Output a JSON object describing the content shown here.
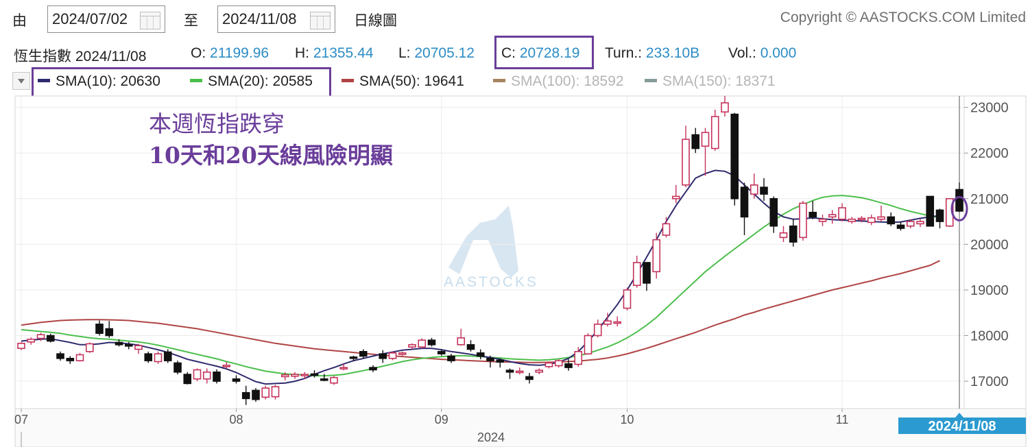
{
  "toolbar": {
    "from_label": "由",
    "from_date": "2024/07/02",
    "to_label": "至",
    "to_date": "2024/11/08",
    "chart_type": "日線圖",
    "copyright": "Copyright © AASTOCKS.COM Limited"
  },
  "quote": {
    "name": "恆生指數",
    "date": "2024/11/08",
    "open_label": "O:",
    "open": "21199.96",
    "high_label": "H:",
    "high": "21355.44",
    "low_label": "L:",
    "low": "20705.12",
    "close_label": "C:",
    "close": "20728.19",
    "turnover_label": "Turn.:",
    "turnover": "233.10B",
    "volume_label": "Vol.:",
    "volume": "0.000"
  },
  "indicators": [
    {
      "label": "SMA(10): 20630",
      "color": "#2e2a6e",
      "active": true
    },
    {
      "label": "SMA(20): 20585",
      "color": "#4bbf4b",
      "active": true
    },
    {
      "label": "SMA(50): 19641",
      "color": "#b04444",
      "active": true
    },
    {
      "label": "SMA(100): 18592",
      "color": "#8b5a2b",
      "active": false
    },
    {
      "label": "SMA(150): 18371",
      "color": "#5f7a78",
      "active": false
    }
  ],
  "annotation": {
    "line1": "本週恆指跌穿",
    "line2": "10天和20天線風險明顯"
  },
  "watermark": "AASTOCKS",
  "colors": {
    "up_candle": "#c4325a",
    "down_candle": "#111111",
    "highlight": "#6a3d9a",
    "value_text": "#2b8cc4",
    "date_badge": "#2b9ad0"
  },
  "chart_data": {
    "type": "candlestick",
    "ylim": [
      16400,
      23250
    ],
    "yticks": [
      "23000",
      "22000",
      "21000",
      "20000",
      "19000",
      "18000",
      "17000"
    ],
    "ytick_values": [
      23000,
      22000,
      21000,
      20000,
      19000,
      18000,
      17000
    ],
    "xtick_labels": [
      "07",
      "08",
      "09",
      "10",
      "11"
    ],
    "xtick_index": [
      0,
      22,
      43,
      62,
      84
    ],
    "year_label": "2024",
    "last_date_badge": "2024/11/08",
    "candles": [
      [
        17720,
        17860,
        17680,
        17830
      ],
      [
        17860,
        17960,
        17800,
        17920
      ],
      [
        17940,
        18060,
        17880,
        18020
      ],
      [
        18000,
        18040,
        17850,
        17880
      ],
      [
        17600,
        17650,
        17450,
        17500
      ],
      [
        17500,
        17550,
        17380,
        17450
      ],
      [
        17450,
        17620,
        17430,
        17580
      ],
      [
        17650,
        17850,
        17620,
        17820
      ],
      [
        18250,
        18330,
        18000,
        18050
      ],
      [
        18150,
        18320,
        17950,
        18000
      ],
      [
        17850,
        17920,
        17760,
        17800
      ],
      [
        17800,
        17860,
        17700,
        17770
      ],
      [
        17700,
        17820,
        17600,
        17780
      ],
      [
        17600,
        17650,
        17400,
        17450
      ],
      [
        17430,
        17650,
        17380,
        17600
      ],
      [
        17640,
        17700,
        17400,
        17450
      ],
      [
        17400,
        17450,
        17150,
        17200
      ],
      [
        17150,
        17200,
        16930,
        16950
      ],
      [
        17050,
        17280,
        17000,
        17250
      ],
      [
        17050,
        17280,
        16950,
        17200
      ],
      [
        17200,
        17260,
        16950,
        17000
      ],
      [
        17350,
        17420,
        17280,
        17350
      ],
      [
        17050,
        17130,
        16950,
        17000
      ],
      [
        16750,
        16900,
        16480,
        16620
      ],
      [
        16800,
        16850,
        16550,
        16600
      ],
      [
        16650,
        16900,
        16600,
        16850
      ],
      [
        16660,
        16920,
        16600,
        16880
      ],
      [
        17100,
        17200,
        17020,
        17140
      ],
      [
        17110,
        17200,
        17050,
        17150
      ],
      [
        17120,
        17200,
        17050,
        17150
      ],
      [
        17160,
        17240,
        17080,
        17150
      ],
      [
        17050,
        17160,
        17000,
        17020
      ],
      [
        16960,
        17120,
        16920,
        17080
      ],
      [
        17270,
        17380,
        17240,
        17300
      ],
      [
        17530,
        17560,
        17440,
        17500
      ],
      [
        17650,
        17700,
        17500,
        17550
      ],
      [
        17300,
        17350,
        17200,
        17250
      ],
      [
        17600,
        17680,
        17400,
        17500
      ],
      [
        17500,
        17650,
        17460,
        17620
      ],
      [
        17600,
        17650,
        17560,
        17620
      ],
      [
        17750,
        17830,
        17700,
        17800
      ],
      [
        17750,
        17940,
        17720,
        17900
      ],
      [
        17900,
        17950,
        17760,
        17800
      ],
      [
        17650,
        17700,
        17560,
        17600
      ],
      [
        17550,
        17600,
        17400,
        17450
      ],
      [
        17800,
        18150,
        17780,
        17950
      ],
      [
        17800,
        17900,
        17650,
        17700
      ],
      [
        17620,
        17700,
        17480,
        17550
      ],
      [
        17500,
        17560,
        17300,
        17450
      ],
      [
        17460,
        17500,
        17300,
        17420
      ],
      [
        17240,
        17280,
        17050,
        17200
      ],
      [
        17190,
        17300,
        17150,
        17220
      ],
      [
        17100,
        17180,
        16950,
        17040
      ],
      [
        17200,
        17280,
        17150,
        17240
      ],
      [
        17320,
        17430,
        17280,
        17400
      ],
      [
        17340,
        17480,
        17300,
        17450
      ],
      [
        17380,
        17480,
        17230,
        17300
      ],
      [
        17370,
        17750,
        17320,
        17650
      ],
      [
        17600,
        18050,
        17580,
        18000
      ],
      [
        18000,
        18350,
        17960,
        18250
      ],
      [
        18250,
        18500,
        18200,
        18320
      ],
      [
        18280,
        18420,
        18200,
        18300
      ],
      [
        18600,
        19050,
        18550,
        19000
      ],
      [
        19100,
        19750,
        19050,
        19600
      ],
      [
        19600,
        19150,
        18980,
        19150
      ],
      [
        19400,
        20250,
        19250,
        20100
      ],
      [
        20200,
        20600,
        20150,
        20450
      ],
      [
        21000,
        21300,
        20900,
        21050
      ],
      [
        21300,
        22600,
        21250,
        22300
      ],
      [
        22400,
        22550,
        22000,
        22100
      ],
      [
        22150,
        22550,
        21500,
        22450
      ],
      [
        22100,
        22950,
        22050,
        22800
      ],
      [
        22900,
        23250,
        22800,
        23100
      ],
      [
        22850,
        22880,
        20850,
        21000
      ],
      [
        21250,
        21350,
        20200,
        20600
      ],
      [
        21100,
        21550,
        21000,
        21300
      ],
      [
        21250,
        21450,
        20950,
        21100
      ],
      [
        21000,
        21050,
        20250,
        20400
      ],
      [
        20150,
        20400,
        20050,
        20250
      ],
      [
        20400,
        20550,
        19950,
        20050
      ],
      [
        20150,
        20950,
        20080,
        20900
      ],
      [
        20700,
        20950,
        20550,
        20600
      ],
      [
        20500,
        20650,
        20400,
        20550
      ],
      [
        20600,
        20750,
        20450,
        20650
      ],
      [
        20550,
        20900,
        20500,
        20800
      ],
      [
        20500,
        20600,
        20450,
        20550
      ],
      [
        20560,
        20620,
        20480,
        20570
      ],
      [
        20480,
        20650,
        20420,
        20580
      ],
      [
        20550,
        20850,
        20500,
        20600
      ],
      [
        20600,
        20700,
        20400,
        20450
      ],
      [
        20420,
        20500,
        20300,
        20350
      ],
      [
        20400,
        20550,
        20350,
        20500
      ],
      [
        20450,
        20550,
        20380,
        20500
      ],
      [
        21050,
        21050,
        20950,
        20400
      ],
      [
        20750,
        20780,
        20350,
        20500
      ],
      [
        20400,
        21000,
        20380,
        21000
      ],
      [
        21199.96,
        21355.44,
        20705.12,
        20728.19
      ]
    ],
    "sma10": [
      17880,
      17900,
      17920,
      17930,
      17890,
      17850,
      17800,
      17800,
      17820,
      17850,
      17840,
      17820,
      17790,
      17740,
      17690,
      17630,
      17560,
      17480,
      17430,
      17380,
      17330,
      17270,
      17190,
      17090,
      16990,
      16940,
      16950,
      16960,
      17000,
      17060,
      17150,
      17230,
      17300,
      17380,
      17450,
      17500,
      17550,
      17600,
      17640,
      17680,
      17700,
      17720,
      17720,
      17690,
      17650,
      17620,
      17590,
      17550,
      17520,
      17480,
      17430,
      17390,
      17360,
      17350,
      17370,
      17420,
      17500,
      17650,
      17870,
      18120,
      18400,
      18680,
      19000,
      19350,
      19720,
      20100,
      20500,
      20850,
      21150,
      21450,
      21550,
      21620,
      21600,
      21500,
      21300,
      21100,
      20900,
      20720,
      20600,
      20550,
      20560,
      20580,
      20560,
      20540,
      20530,
      20520,
      20510,
      20500,
      20490,
      20480,
      20490,
      20530,
      20570,
      20600,
      20630
    ],
    "sma20": [
      18130,
      18110,
      18090,
      18070,
      18050,
      18010,
      17980,
      17950,
      17930,
      17920,
      17900,
      17880,
      17860,
      17830,
      17790,
      17740,
      17690,
      17640,
      17590,
      17540,
      17490,
      17430,
      17380,
      17320,
      17270,
      17220,
      17190,
      17160,
      17150,
      17140,
      17120,
      17120,
      17130,
      17150,
      17190,
      17230,
      17280,
      17330,
      17380,
      17430,
      17470,
      17500,
      17520,
      17540,
      17550,
      17560,
      17550,
      17540,
      17520,
      17510,
      17490,
      17480,
      17470,
      17460,
      17470,
      17490,
      17520,
      17560,
      17610,
      17680,
      17750,
      17840,
      17950,
      18080,
      18230,
      18400,
      18600,
      18800,
      19000,
      19200,
      19400,
      19570,
      19740,
      19900,
      20060,
      20220,
      20380,
      20520,
      20660,
      20780,
      20870,
      20960,
      21030,
      21060,
      21070,
      21050,
      21020,
      20970,
      20910,
      20850,
      20780,
      20720,
      20670,
      20620,
      20585
    ],
    "sma50": [
      18230,
      18260,
      18290,
      18310,
      18330,
      18340,
      18345,
      18350,
      18350,
      18345,
      18340,
      18330,
      18310,
      18290,
      18270,
      18240,
      18210,
      18180,
      18150,
      18110,
      18070,
      18030,
      17990,
      17950,
      17910,
      17870,
      17830,
      17800,
      17770,
      17740,
      17710,
      17690,
      17670,
      17650,
      17630,
      17610,
      17590,
      17570,
      17555,
      17540,
      17525,
      17510,
      17495,
      17480,
      17470,
      17460,
      17450,
      17440,
      17430,
      17425,
      17420,
      17415,
      17410,
      17410,
      17415,
      17420,
      17430,
      17440,
      17460,
      17480,
      17510,
      17550,
      17600,
      17660,
      17720,
      17790,
      17860,
      17930,
      18000,
      18070,
      18150,
      18230,
      18300,
      18370,
      18450,
      18510,
      18580,
      18640,
      18700,
      18760,
      18820,
      18880,
      18940,
      19000,
      19050,
      19100,
      19150,
      19200,
      19260,
      19310,
      19360,
      19420,
      19480,
      19540,
      19641
    ]
  }
}
